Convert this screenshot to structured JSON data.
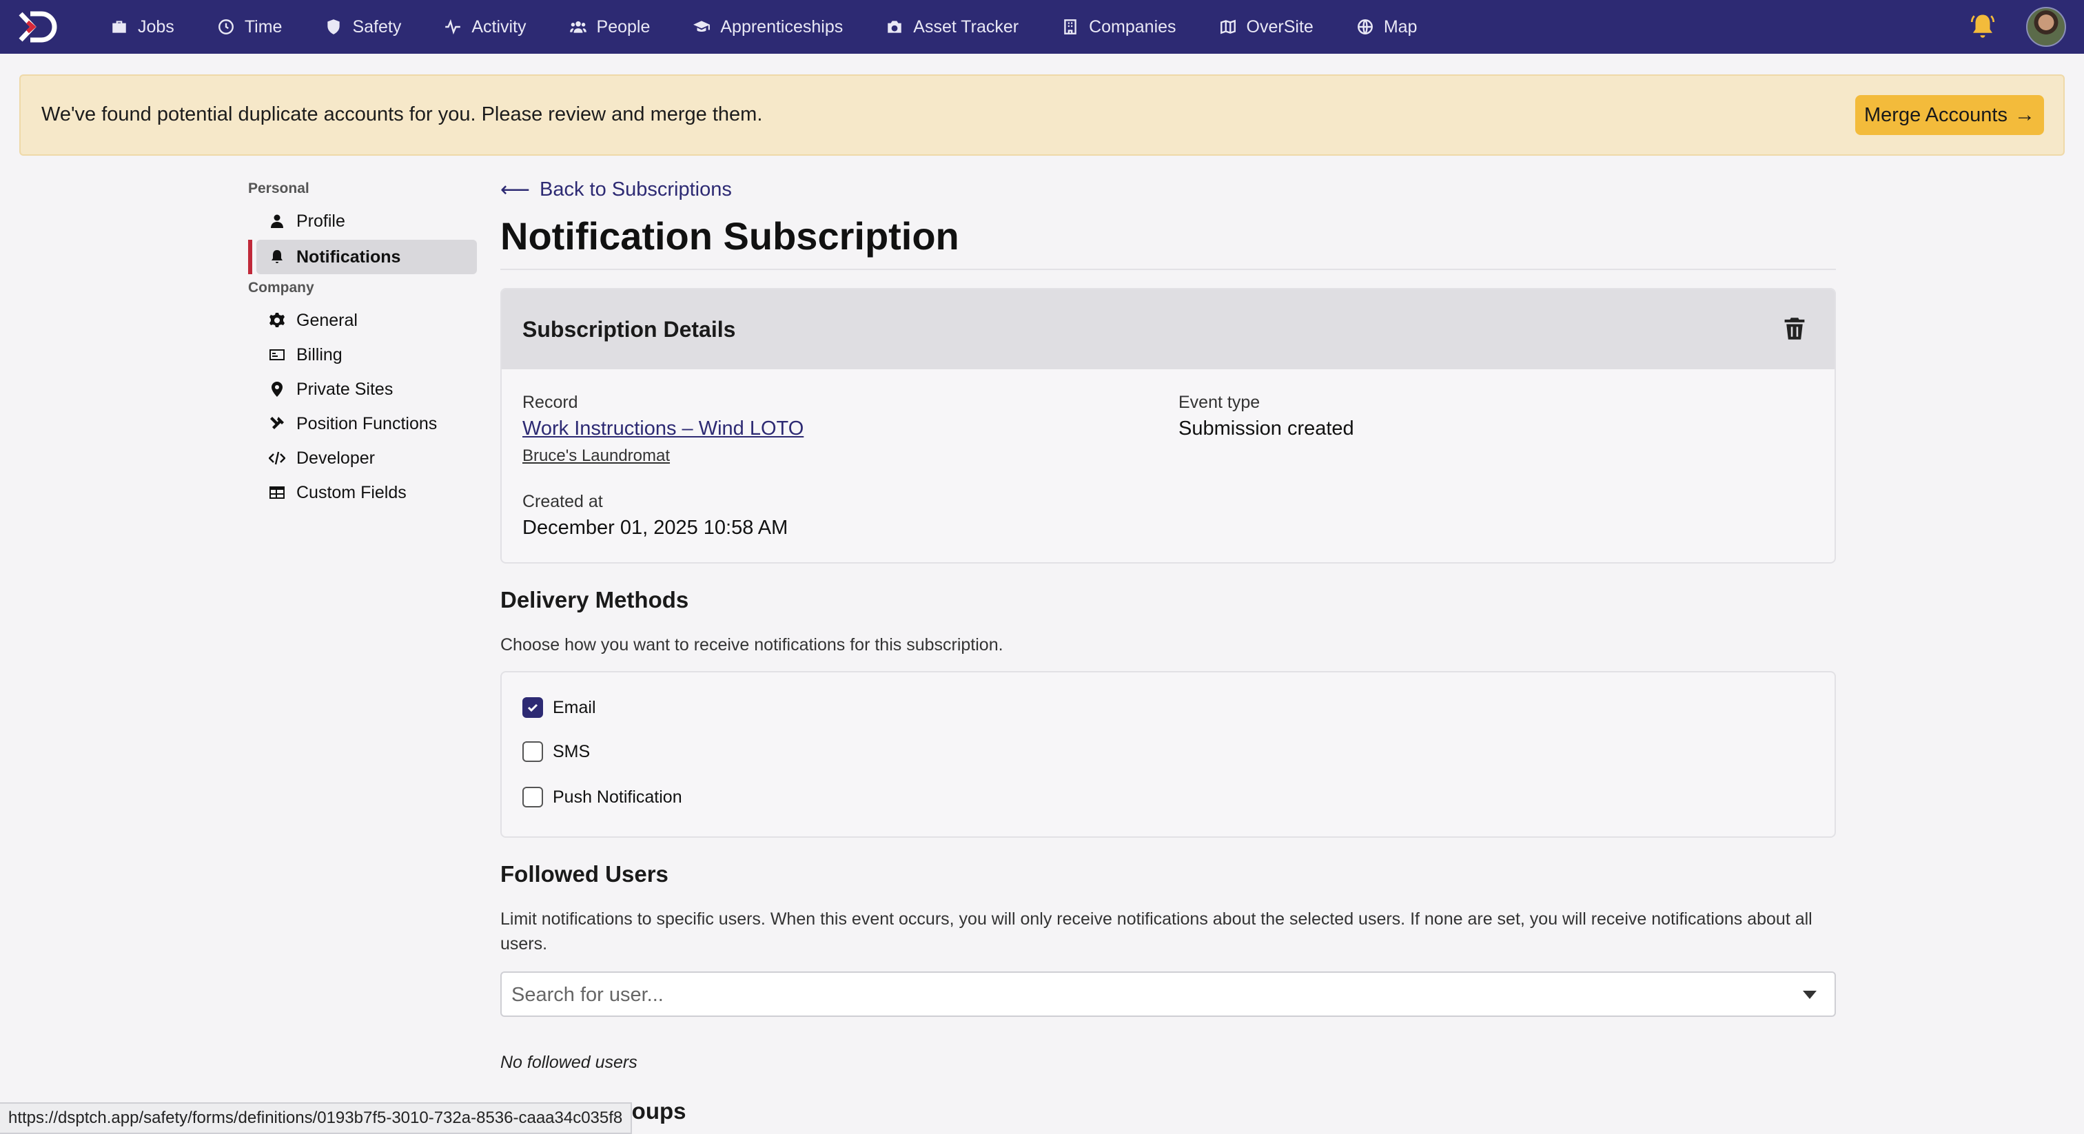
{
  "nav": {
    "items": [
      {
        "label": "Jobs",
        "icon": "briefcase-icon"
      },
      {
        "label": "Time",
        "icon": "clock-icon"
      },
      {
        "label": "Safety",
        "icon": "shield-icon"
      },
      {
        "label": "Activity",
        "icon": "pulse-icon"
      },
      {
        "label": "People",
        "icon": "people-icon"
      },
      {
        "label": "Apprenticeships",
        "icon": "graduation-cap-icon"
      },
      {
        "label": "Asset Tracker",
        "icon": "camera-icon"
      },
      {
        "label": "Companies",
        "icon": "building-icon"
      },
      {
        "label": "OverSite",
        "icon": "map-fold-icon"
      },
      {
        "label": "Map",
        "icon": "globe-icon"
      }
    ],
    "brand_color": "#2d2a73",
    "bell_color": "#f3bb3b"
  },
  "banner": {
    "message": "We've found potential duplicate accounts for you. Please review and merge them.",
    "button_label": "Merge Accounts",
    "button_arrow": "→"
  },
  "sidebar": {
    "personal_heading": "Personal",
    "company_heading": "Company",
    "personal_items": [
      {
        "label": "Profile",
        "icon": "user-icon"
      },
      {
        "label": "Notifications",
        "icon": "bell-icon",
        "active": true
      }
    ],
    "company_items": [
      {
        "label": "General",
        "icon": "gear-icon"
      },
      {
        "label": "Billing",
        "icon": "billing-card-icon"
      },
      {
        "label": "Private Sites",
        "icon": "map-pin-icon"
      },
      {
        "label": "Position Functions",
        "icon": "tools-icon"
      },
      {
        "label": "Developer",
        "icon": "code-icon"
      },
      {
        "label": "Custom Fields",
        "icon": "table-icon"
      }
    ]
  },
  "main": {
    "back_arrow": "⟵",
    "back_label": "Back to Subscriptions",
    "title": "Notification Subscription",
    "details": {
      "heading": "Subscription Details",
      "record_label": "Record",
      "record_link": "Work Instructions – Wind LOTO",
      "record_company": "Bruce's Laundromat",
      "event_type_label": "Event type",
      "event_type_value": "Submission created",
      "created_at_label": "Created at",
      "created_at_value": "December 01, 2025 10:58 AM"
    },
    "delivery": {
      "heading": "Delivery Methods",
      "description": "Choose how you want to receive notifications for this subscription.",
      "methods": [
        {
          "label": "Email",
          "checked": true
        },
        {
          "label": "SMS",
          "checked": false
        },
        {
          "label": "Push Notification",
          "checked": false
        }
      ]
    },
    "followed_users": {
      "heading": "Followed Users",
      "description": "Limit notifications to specific users. When this event occurs, you will only receive notifications about the selected users. If none are set, you will receive notifications about all users.",
      "search_placeholder": "Search for user...",
      "empty_text": "No followed users"
    },
    "next_heading_partial": "Followed Groups"
  },
  "status_bar": {
    "url": "https://dsptch.app/safety/forms/definitions/0193b7f5-3010-732a-8536-caaa34c035f8"
  }
}
